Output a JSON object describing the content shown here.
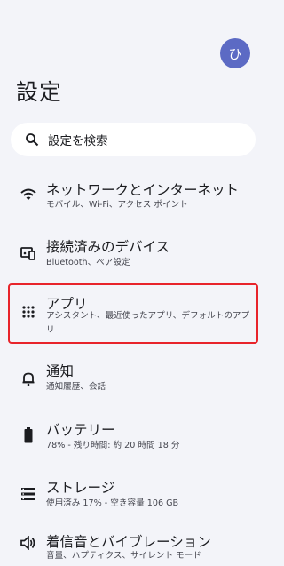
{
  "header": {
    "avatar_initial": "ひ",
    "title": "設定"
  },
  "search": {
    "label": "設定を検索",
    "icon": "search-icon"
  },
  "highlight_color": "#e8242b",
  "items": [
    {
      "title": "ネットワークとインターネット",
      "subtitle": "モバイル、Wi-Fi、アクセス ポイント",
      "icon": "wifi-icon"
    },
    {
      "title": "接続済みのデバイス",
      "subtitle": "Bluetooth、ペア設定",
      "icon": "devices-icon"
    },
    {
      "title": "アプリ",
      "subtitle": "アシスタント、最近使ったアプリ、デフォルトのアプリ",
      "icon": "apps-grid-icon"
    },
    {
      "title": "通知",
      "subtitle": "通知履歴、会話",
      "icon": "bell-icon"
    },
    {
      "title": "バッテリー",
      "subtitle": "78% - 残り時間: 約 20 時間 18 分",
      "icon": "battery-icon"
    },
    {
      "title": "ストレージ",
      "subtitle": "使用済み 17% - 空き容量 106 GB",
      "icon": "storage-icon"
    },
    {
      "title": "着信音とバイブレーション",
      "subtitle": "音量、ハプティクス、サイレント モード",
      "icon": "volume-icon"
    }
  ]
}
